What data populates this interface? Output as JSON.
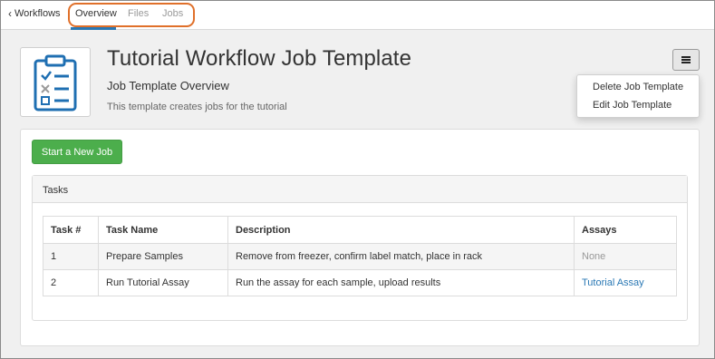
{
  "nav": {
    "back_label": "Workflows",
    "tabs": [
      {
        "label": "Overview",
        "active": true
      },
      {
        "label": "Files",
        "active": false
      },
      {
        "label": "Jobs",
        "active": false
      }
    ]
  },
  "header": {
    "icon": "clipboard-checklist-icon",
    "title": "Tutorial Workflow Job Template",
    "subtitle": "Job Template Overview",
    "description": "This template creates jobs for the tutorial",
    "menu_icon": "hamburger-icon"
  },
  "menu": {
    "items": [
      "Delete Job Template",
      "Edit Job Template"
    ]
  },
  "actions": {
    "start_label": "Start a New Job"
  },
  "tasks": {
    "title": "Tasks",
    "columns": [
      "Task #",
      "Task Name",
      "Description",
      "Assays"
    ],
    "rows": [
      {
        "num": "1",
        "name": "Prepare Samples",
        "description": "Remove from freezer, confirm label match, place in rack",
        "assays": "None"
      },
      {
        "num": "2",
        "name": "Run Tutorial Assay",
        "description": "Run the assay for each sample, upload results",
        "assays": "Tutorial Assay"
      }
    ]
  },
  "colors": {
    "accent": "#2a78b4",
    "highlight_outline": "#e0702a",
    "primary_button": "#4cae4c",
    "icon_blue": "#1f6fb2"
  }
}
